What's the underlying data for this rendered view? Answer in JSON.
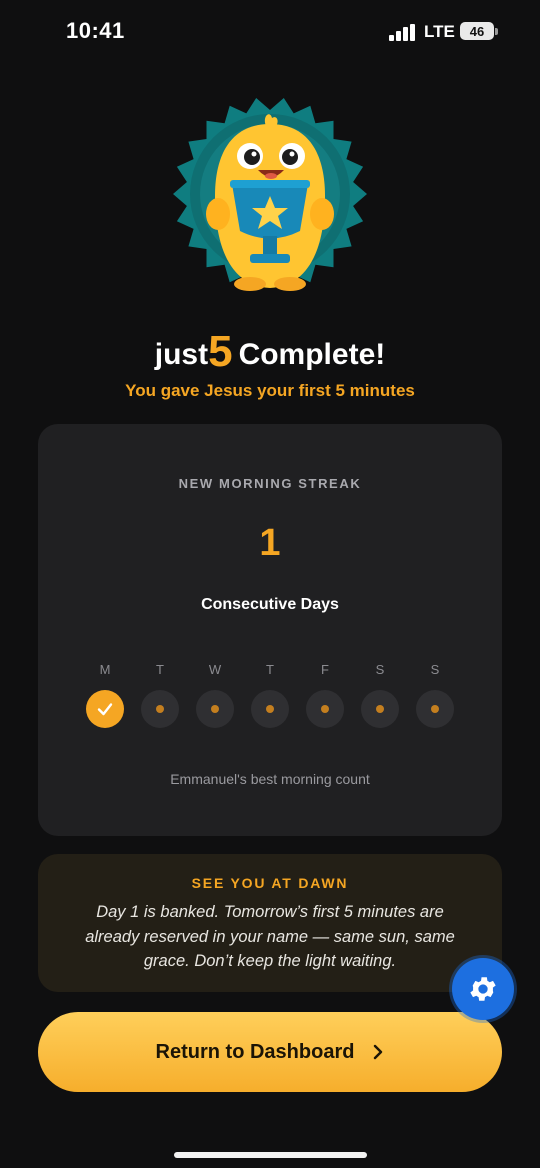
{
  "status_bar": {
    "time": "10:41",
    "network": "LTE",
    "battery": "46"
  },
  "title": {
    "prefix": "just",
    "number": "5",
    "suffix": "Complete!"
  },
  "subtitle": "You gave Jesus your first 5 minutes",
  "streak": {
    "label": "NEW MORNING STREAK",
    "count": "1",
    "unit": "Consecutive Days",
    "days": [
      {
        "letter": "M",
        "done": true
      },
      {
        "letter": "T",
        "done": false
      },
      {
        "letter": "W",
        "done": false
      },
      {
        "letter": "T",
        "done": false
      },
      {
        "letter": "F",
        "done": false
      },
      {
        "letter": "S",
        "done": false
      },
      {
        "letter": "S",
        "done": false
      }
    ],
    "best_caption": "Emmanuel's best morning count"
  },
  "dawn": {
    "title": "SEE YOU AT DAWN",
    "message": "Day 1 is banked. Tomorrow’s first 5 minutes are already reserved in your name — same sun, same grace. Don’t keep the light waiting."
  },
  "cta": {
    "label": "Return to Dashboard",
    "icon": "chevron-right-icon"
  },
  "colors": {
    "accent": "#f5a623",
    "background": "#0f0f10",
    "card": "#202022",
    "fab": "#1d6fe0"
  },
  "icons": {
    "mascot": "trophy-mascot-icon",
    "settings": "gear-icon",
    "check": "check-icon"
  }
}
